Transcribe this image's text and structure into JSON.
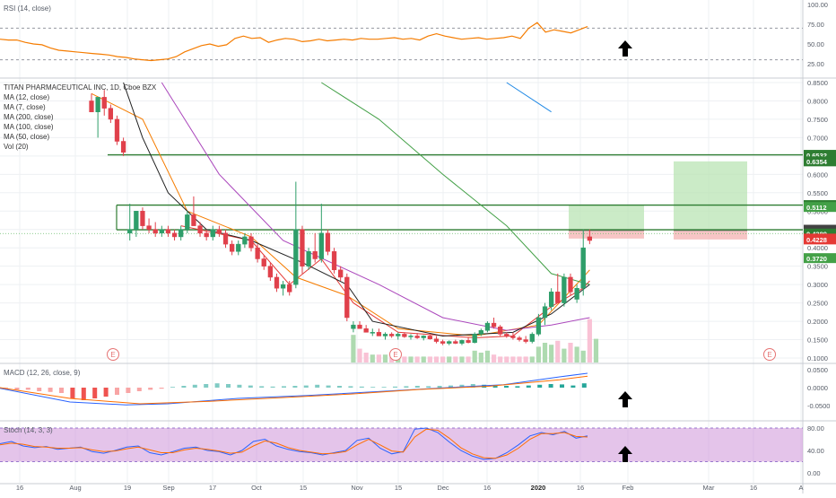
{
  "colors": {
    "bg": "#ffffff",
    "grid": "#eef0f3",
    "divider": "#c9ccd3",
    "axis_text": "#555b66",
    "up": "#26a69a",
    "down": "#ef5350",
    "candle_up": "#2e9e6a",
    "candle_down": "#e0404b",
    "rsi_line": "#f57c00",
    "rsi_band": "#9598a1",
    "ma12": "#f57c00",
    "ma7": "#e53935",
    "ma200": "#1e88e5",
    "ma100": "#43a047",
    "ma50": "#ab47bc",
    "ma_black": "#212121",
    "level_line": "#2e7d32",
    "target_zone": "#b9e4b4",
    "stop_zone": "#f5b7b7",
    "stoch_bg": "#ce93d8",
    "stoch_k": "#2962ff",
    "stoch_d": "#ff6d00",
    "macd_line": "#2962ff",
    "signal_line": "#ff6d00",
    "arrow": "#000000",
    "earnings": "#e57373"
  },
  "panes": {
    "rsi": {
      "label": "RSI (14, close)",
      "ticks": [
        "100.00",
        "75.00",
        "50.00",
        "25.00"
      ]
    },
    "price": {
      "legend": [
        "TITAN PHARMACEUTICAL INC, 1D, Cboe BZX",
        "MA (12, close)",
        "MA (7, close)",
        "MA (200, close)",
        "MA (100, close)",
        "MA (50, close)",
        "Vol (20)"
      ],
      "ticks": [
        "0.8500",
        "0.8000",
        "0.7500",
        "0.7000",
        "0.6500",
        "0.6000",
        "0.5500",
        "0.5000",
        "0.4500",
        "0.4000",
        "0.3500",
        "0.3000",
        "0.2500",
        "0.2000",
        "0.1500",
        "0.1000"
      ],
      "earnings_label": "E"
    },
    "macd": {
      "label": "MACD (12, 26, close, 9)",
      "ticks": [
        "0.0500",
        "0.0000",
        "-0.0500"
      ]
    },
    "stoch": {
      "label": "Stoch (14, 3, 3)",
      "ticks": [
        "80.00",
        "40.00",
        "0.00"
      ]
    }
  },
  "price_badges": [
    {
      "text": "0.6532",
      "value": 0.6532,
      "color": "#2e7d32"
    },
    {
      "text": "0.6354",
      "value": 0.6354,
      "color": "#2e7d32"
    },
    {
      "text": "0.5164",
      "value": 0.5164,
      "color": "#2e7d32"
    },
    {
      "text": "0.5112",
      "value": 0.5112,
      "color": "#43a047"
    },
    {
      "text": "0.4493",
      "value": 0.4493,
      "color": "#424242"
    },
    {
      "text": "0.4471",
      "value": 0.4471,
      "color": "#424242"
    },
    {
      "text": "0.4389",
      "value": 0.4389,
      "color": "#2e7d32"
    },
    {
      "text": "0.4252",
      "value": 0.4252,
      "color": "#e53935"
    },
    {
      "text": "0.4228",
      "value": 0.4228,
      "color": "#e53935"
    },
    {
      "text": "0.3720",
      "value": 0.372,
      "color": "#43a047"
    }
  ],
  "time_axis": [
    "16",
    "Aug",
    "19",
    "Sep",
    "17",
    "Oct",
    "15",
    "Nov",
    "15",
    "Dec",
    "16",
    "2020",
    "16",
    "Feb",
    "Mar",
    "16",
    "A"
  ],
  "chart_data": {
    "type": "candlestick",
    "title": "TITAN PHARMACEUTICAL INC, 1D, Cboe BZX",
    "price_range": [
      0.1,
      0.85
    ],
    "horizontal_levels": [
      0.6532,
      0.5164,
      0.4493
    ],
    "current_price": 0.4389,
    "candles": [
      {
        "o": 0.8,
        "h": 0.82,
        "l": 0.78,
        "c": 0.77
      },
      {
        "o": 0.77,
        "h": 0.79,
        "l": 0.7,
        "c": 0.81
      },
      {
        "o": 0.81,
        "h": 0.83,
        "l": 0.76,
        "c": 0.78
      },
      {
        "o": 0.78,
        "h": 0.79,
        "l": 0.74,
        "c": 0.75
      },
      {
        "o": 0.75,
        "h": 0.76,
        "l": 0.68,
        "c": 0.69
      },
      {
        "o": 0.69,
        "h": 0.7,
        "l": 0.65,
        "c": 0.66
      },
      {
        "o": 0.44,
        "h": 0.52,
        "l": 0.42,
        "c": 0.45
      },
      {
        "o": 0.45,
        "h": 0.5,
        "l": 0.43,
        "c": 0.5
      },
      {
        "o": 0.5,
        "h": 0.51,
        "l": 0.45,
        "c": 0.46
      },
      {
        "o": 0.46,
        "h": 0.48,
        "l": 0.44,
        "c": 0.45
      },
      {
        "o": 0.45,
        "h": 0.47,
        "l": 0.43,
        "c": 0.44
      },
      {
        "o": 0.44,
        "h": 0.46,
        "l": 0.43,
        "c": 0.45
      },
      {
        "o": 0.45,
        "h": 0.46,
        "l": 0.43,
        "c": 0.44
      },
      {
        "o": 0.44,
        "h": 0.45,
        "l": 0.42,
        "c": 0.43
      },
      {
        "o": 0.43,
        "h": 0.46,
        "l": 0.42,
        "c": 0.45
      },
      {
        "o": 0.45,
        "h": 0.5,
        "l": 0.44,
        "c": 0.49
      },
      {
        "o": 0.49,
        "h": 0.54,
        "l": 0.46,
        "c": 0.46
      },
      {
        "o": 0.46,
        "h": 0.47,
        "l": 0.43,
        "c": 0.44
      },
      {
        "o": 0.44,
        "h": 0.45,
        "l": 0.42,
        "c": 0.43
      },
      {
        "o": 0.43,
        "h": 0.46,
        "l": 0.42,
        "c": 0.45
      },
      {
        "o": 0.45,
        "h": 0.46,
        "l": 0.43,
        "c": 0.44
      },
      {
        "o": 0.44,
        "h": 0.45,
        "l": 0.4,
        "c": 0.41
      },
      {
        "o": 0.41,
        "h": 0.42,
        "l": 0.38,
        "c": 0.39
      },
      {
        "o": 0.39,
        "h": 0.42,
        "l": 0.38,
        "c": 0.41
      },
      {
        "o": 0.41,
        "h": 0.44,
        "l": 0.4,
        "c": 0.43
      },
      {
        "o": 0.43,
        "h": 0.44,
        "l": 0.39,
        "c": 0.4
      },
      {
        "o": 0.4,
        "h": 0.41,
        "l": 0.36,
        "c": 0.37
      },
      {
        "o": 0.37,
        "h": 0.38,
        "l": 0.34,
        "c": 0.35
      },
      {
        "o": 0.35,
        "h": 0.36,
        "l": 0.31,
        "c": 0.32
      },
      {
        "o": 0.32,
        "h": 0.33,
        "l": 0.28,
        "c": 0.29
      },
      {
        "o": 0.29,
        "h": 0.31,
        "l": 0.27,
        "c": 0.3
      },
      {
        "o": 0.3,
        "h": 0.31,
        "l": 0.27,
        "c": 0.28
      },
      {
        "o": 0.3,
        "h": 0.58,
        "l": 0.29,
        "c": 0.45
      },
      {
        "o": 0.45,
        "h": 0.46,
        "l": 0.33,
        "c": 0.35
      },
      {
        "o": 0.35,
        "h": 0.4,
        "l": 0.34,
        "c": 0.39
      },
      {
        "o": 0.39,
        "h": 0.44,
        "l": 0.36,
        "c": 0.37
      },
      {
        "o": 0.37,
        "h": 0.52,
        "l": 0.36,
        "c": 0.44
      },
      {
        "o": 0.44,
        "h": 0.45,
        "l": 0.38,
        "c": 0.39
      },
      {
        "o": 0.39,
        "h": 0.4,
        "l": 0.33,
        "c": 0.34
      },
      {
        "o": 0.34,
        "h": 0.35,
        "l": 0.31,
        "c": 0.32
      },
      {
        "o": 0.32,
        "h": 0.33,
        "l": 0.2,
        "c": 0.21
      },
      {
        "o": 0.18,
        "h": 0.2,
        "l": 0.17,
        "c": 0.19
      },
      {
        "o": 0.19,
        "h": 0.2,
        "l": 0.18,
        "c": 0.18
      },
      {
        "o": 0.18,
        "h": 0.19,
        "l": 0.17,
        "c": 0.17
      },
      {
        "o": 0.17,
        "h": 0.18,
        "l": 0.16,
        "c": 0.17
      },
      {
        "o": 0.17,
        "h": 0.18,
        "l": 0.16,
        "c": 0.16
      },
      {
        "o": 0.16,
        "h": 0.17,
        "l": 0.15,
        "c": 0.165
      },
      {
        "o": 0.165,
        "h": 0.17,
        "l": 0.155,
        "c": 0.16
      },
      {
        "o": 0.16,
        "h": 0.17,
        "l": 0.15,
        "c": 0.165
      },
      {
        "o": 0.165,
        "h": 0.17,
        "l": 0.155,
        "c": 0.158
      },
      {
        "o": 0.158,
        "h": 0.165,
        "l": 0.15,
        "c": 0.16
      },
      {
        "o": 0.16,
        "h": 0.168,
        "l": 0.152,
        "c": 0.155
      },
      {
        "o": 0.155,
        "h": 0.162,
        "l": 0.148,
        "c": 0.16
      },
      {
        "o": 0.16,
        "h": 0.165,
        "l": 0.15,
        "c": 0.152
      },
      {
        "o": 0.152,
        "h": 0.16,
        "l": 0.14,
        "c": 0.145
      },
      {
        "o": 0.145,
        "h": 0.15,
        "l": 0.135,
        "c": 0.14
      },
      {
        "o": 0.14,
        "h": 0.148,
        "l": 0.135,
        "c": 0.145
      },
      {
        "o": 0.145,
        "h": 0.15,
        "l": 0.138,
        "c": 0.14
      },
      {
        "o": 0.14,
        "h": 0.15,
        "l": 0.135,
        "c": 0.148
      },
      {
        "o": 0.148,
        "h": 0.155,
        "l": 0.14,
        "c": 0.142
      },
      {
        "o": 0.142,
        "h": 0.17,
        "l": 0.14,
        "c": 0.165
      },
      {
        "o": 0.165,
        "h": 0.18,
        "l": 0.16,
        "c": 0.175
      },
      {
        "o": 0.175,
        "h": 0.2,
        "l": 0.17,
        "c": 0.195
      },
      {
        "o": 0.195,
        "h": 0.21,
        "l": 0.18,
        "c": 0.185
      },
      {
        "o": 0.185,
        "h": 0.19,
        "l": 0.16,
        "c": 0.165
      },
      {
        "o": 0.165,
        "h": 0.17,
        "l": 0.155,
        "c": 0.16
      },
      {
        "o": 0.16,
        "h": 0.17,
        "l": 0.15,
        "c": 0.155
      },
      {
        "o": 0.155,
        "h": 0.16,
        "l": 0.145,
        "c": 0.15
      },
      {
        "o": 0.15,
        "h": 0.16,
        "l": 0.14,
        "c": 0.145
      },
      {
        "o": 0.145,
        "h": 0.17,
        "l": 0.14,
        "c": 0.165
      },
      {
        "o": 0.165,
        "h": 0.22,
        "l": 0.16,
        "c": 0.21
      },
      {
        "o": 0.21,
        "h": 0.25,
        "l": 0.19,
        "c": 0.24
      },
      {
        "o": 0.24,
        "h": 0.29,
        "l": 0.23,
        "c": 0.28
      },
      {
        "o": 0.28,
        "h": 0.33,
        "l": 0.26,
        "c": 0.25
      },
      {
        "o": 0.25,
        "h": 0.33,
        "l": 0.24,
        "c": 0.32
      },
      {
        "o": 0.32,
        "h": 0.33,
        "l": 0.27,
        "c": 0.28
      },
      {
        "o": 0.26,
        "h": 0.3,
        "l": 0.25,
        "c": 0.29
      },
      {
        "o": 0.29,
        "h": 0.45,
        "l": 0.27,
        "c": 0.4
      },
      {
        "o": 0.43,
        "h": 0.45,
        "l": 0.41,
        "c": 0.42
      }
    ],
    "moving_averages": [
      {
        "name": "MA (12, close)",
        "points": [
          [
            0,
            0.82
          ],
          [
            8,
            0.75
          ],
          [
            15,
            0.5
          ],
          [
            25,
            0.43
          ],
          [
            32,
            0.32
          ],
          [
            40,
            0.27
          ],
          [
            48,
            0.18
          ],
          [
            60,
            0.16
          ],
          [
            70,
            0.19
          ],
          [
            77,
            0.32
          ],
          [
            78,
            0.34
          ]
        ]
      },
      {
        "name": "MA (7, close)",
        "points": [
          [
            14,
            0.46
          ],
          [
            25,
            0.42
          ],
          [
            31,
            0.3
          ],
          [
            36,
            0.37
          ],
          [
            41,
            0.25
          ],
          [
            48,
            0.17
          ],
          [
            60,
            0.155
          ],
          [
            66,
            0.16
          ],
          [
            72,
            0.24
          ],
          [
            77,
            0.29
          ],
          [
            78,
            0.31
          ]
        ]
      },
      {
        "name": "MA (200, close)",
        "points": [
          [
            65,
            0.85
          ],
          [
            72,
            0.77
          ]
        ]
      },
      {
        "name": "MA (100, close)",
        "points": [
          [
            36,
            0.85
          ],
          [
            45,
            0.75
          ],
          [
            55,
            0.6
          ],
          [
            65,
            0.46
          ],
          [
            72,
            0.33
          ],
          [
            78,
            0.3
          ]
        ]
      },
      {
        "name": "MA (50, close)",
        "points": [
          [
            11,
            0.85
          ],
          [
            20,
            0.6
          ],
          [
            30,
            0.42
          ],
          [
            45,
            0.3
          ],
          [
            55,
            0.21
          ],
          [
            65,
            0.175
          ],
          [
            72,
            0.19
          ],
          [
            78,
            0.21
          ]
        ]
      }
    ],
    "rsi_values": [
      56,
      55,
      55,
      52,
      50,
      49,
      45,
      42,
      41,
      40,
      39,
      38,
      37,
      36,
      34,
      33,
      31,
      30,
      29,
      30,
      31,
      34,
      40,
      44,
      48,
      50,
      47,
      49,
      57,
      60,
      57,
      58,
      52,
      55,
      57,
      56,
      53,
      54,
      56,
      54,
      55,
      56,
      55,
      57,
      56,
      56,
      57,
      58,
      56,
      57,
      55,
      60,
      63,
      60,
      58,
      56,
      57,
      58,
      56,
      57,
      58,
      60,
      57,
      70,
      77,
      65,
      68,
      66,
      64,
      68,
      72
    ],
    "macd_hist": [
      -0.004,
      -0.006,
      -0.006,
      -0.01,
      -0.012,
      -0.015,
      -0.03,
      -0.035,
      -0.03,
      -0.025,
      -0.02,
      -0.015,
      -0.01,
      -0.006,
      -0.003,
      0.002,
      0.005,
      0.008,
      0.01,
      0.012,
      0.01,
      0.008,
      0.006,
      0.004,
      0.003,
      0.004,
      0.005,
      0.006,
      0.008,
      0.006,
      0.005,
      0.004,
      0.003,
      0.002,
      0.002,
      0.003,
      0.004,
      0.005,
      0.004,
      0.005,
      0.006,
      0.008,
      0.01,
      0.008,
      0.006,
      0.005,
      0.004,
      0.006,
      0.008,
      0.01,
      0.009,
      0.006,
      0.012
    ],
    "macd_line": [
      [
        0,
        -0.002
      ],
      [
        10,
        -0.04
      ],
      [
        18,
        -0.048
      ],
      [
        24,
        -0.045
      ],
      [
        34,
        -0.03
      ],
      [
        44,
        -0.022
      ],
      [
        55,
        -0.01
      ],
      [
        64,
        0.0
      ],
      [
        72,
        0.008
      ],
      [
        80,
        0.03
      ],
      [
        84,
        0.04
      ]
    ],
    "signal_line": [
      [
        0,
        0.0
      ],
      [
        10,
        -0.03
      ],
      [
        20,
        -0.045
      ],
      [
        30,
        -0.038
      ],
      [
        40,
        -0.028
      ],
      [
        50,
        -0.018
      ],
      [
        60,
        -0.005
      ],
      [
        70,
        0.004
      ],
      [
        80,
        0.022
      ],
      [
        84,
        0.032
      ]
    ],
    "stoch_k": [
      52,
      56,
      48,
      45,
      47,
      42,
      44,
      46,
      38,
      35,
      40,
      46,
      48,
      36,
      32,
      38,
      44,
      46,
      40,
      38,
      32,
      40,
      56,
      60,
      48,
      42,
      38,
      36,
      32,
      36,
      40,
      58,
      62,
      44,
      34,
      38,
      78,
      80,
      72,
      55,
      40,
      30,
      24,
      26,
      36,
      50,
      66,
      72,
      68,
      74,
      62,
      66
    ],
    "stoch_d": [
      50,
      53,
      51,
      47,
      46,
      44,
      44,
      45,
      41,
      38,
      39,
      43,
      46,
      41,
      36,
      36,
      41,
      44,
      42,
      39,
      35,
      37,
      48,
      57,
      53,
      45,
      40,
      37,
      34,
      35,
      38,
      50,
      60,
      50,
      39,
      37,
      64,
      78,
      76,
      62,
      45,
      34,
      27,
      26,
      32,
      44,
      60,
      70,
      70,
      72,
      65,
      64
    ]
  }
}
